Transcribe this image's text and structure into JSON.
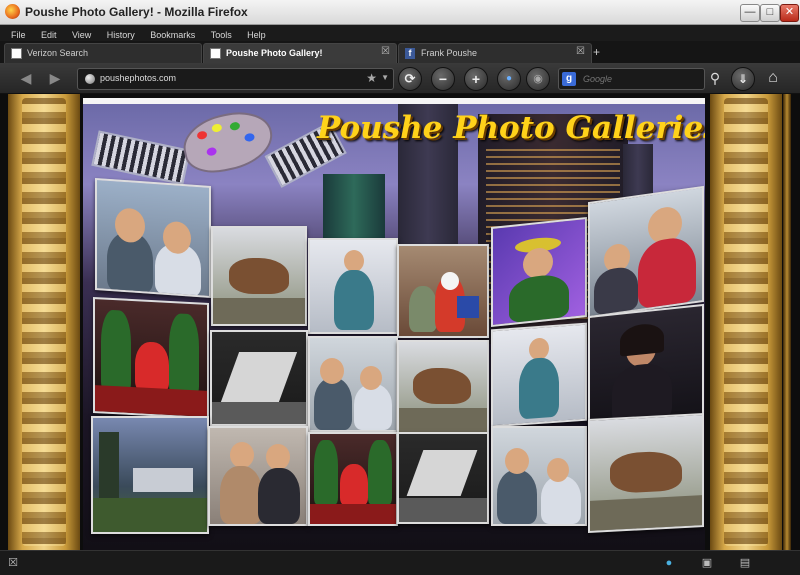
{
  "window": {
    "title": "Poushe Photo Gallery! - Mozilla Firefox"
  },
  "menu": [
    "File",
    "Edit",
    "View",
    "History",
    "Bookmarks",
    "Tools",
    "Help"
  ],
  "tabs": [
    {
      "label": "Verizon Search",
      "active": false
    },
    {
      "label": "Poushe Photo Gallery!",
      "active": true
    },
    {
      "label": "Frank Poushe",
      "active": false
    }
  ],
  "nav": {
    "url": "poushephotos.com",
    "search_placeholder": "Google"
  },
  "page": {
    "banner": "Poushe Photo Galleries"
  },
  "colors": {
    "banner_text": "#ffd21a",
    "frame_gold": "#d7a94a"
  }
}
